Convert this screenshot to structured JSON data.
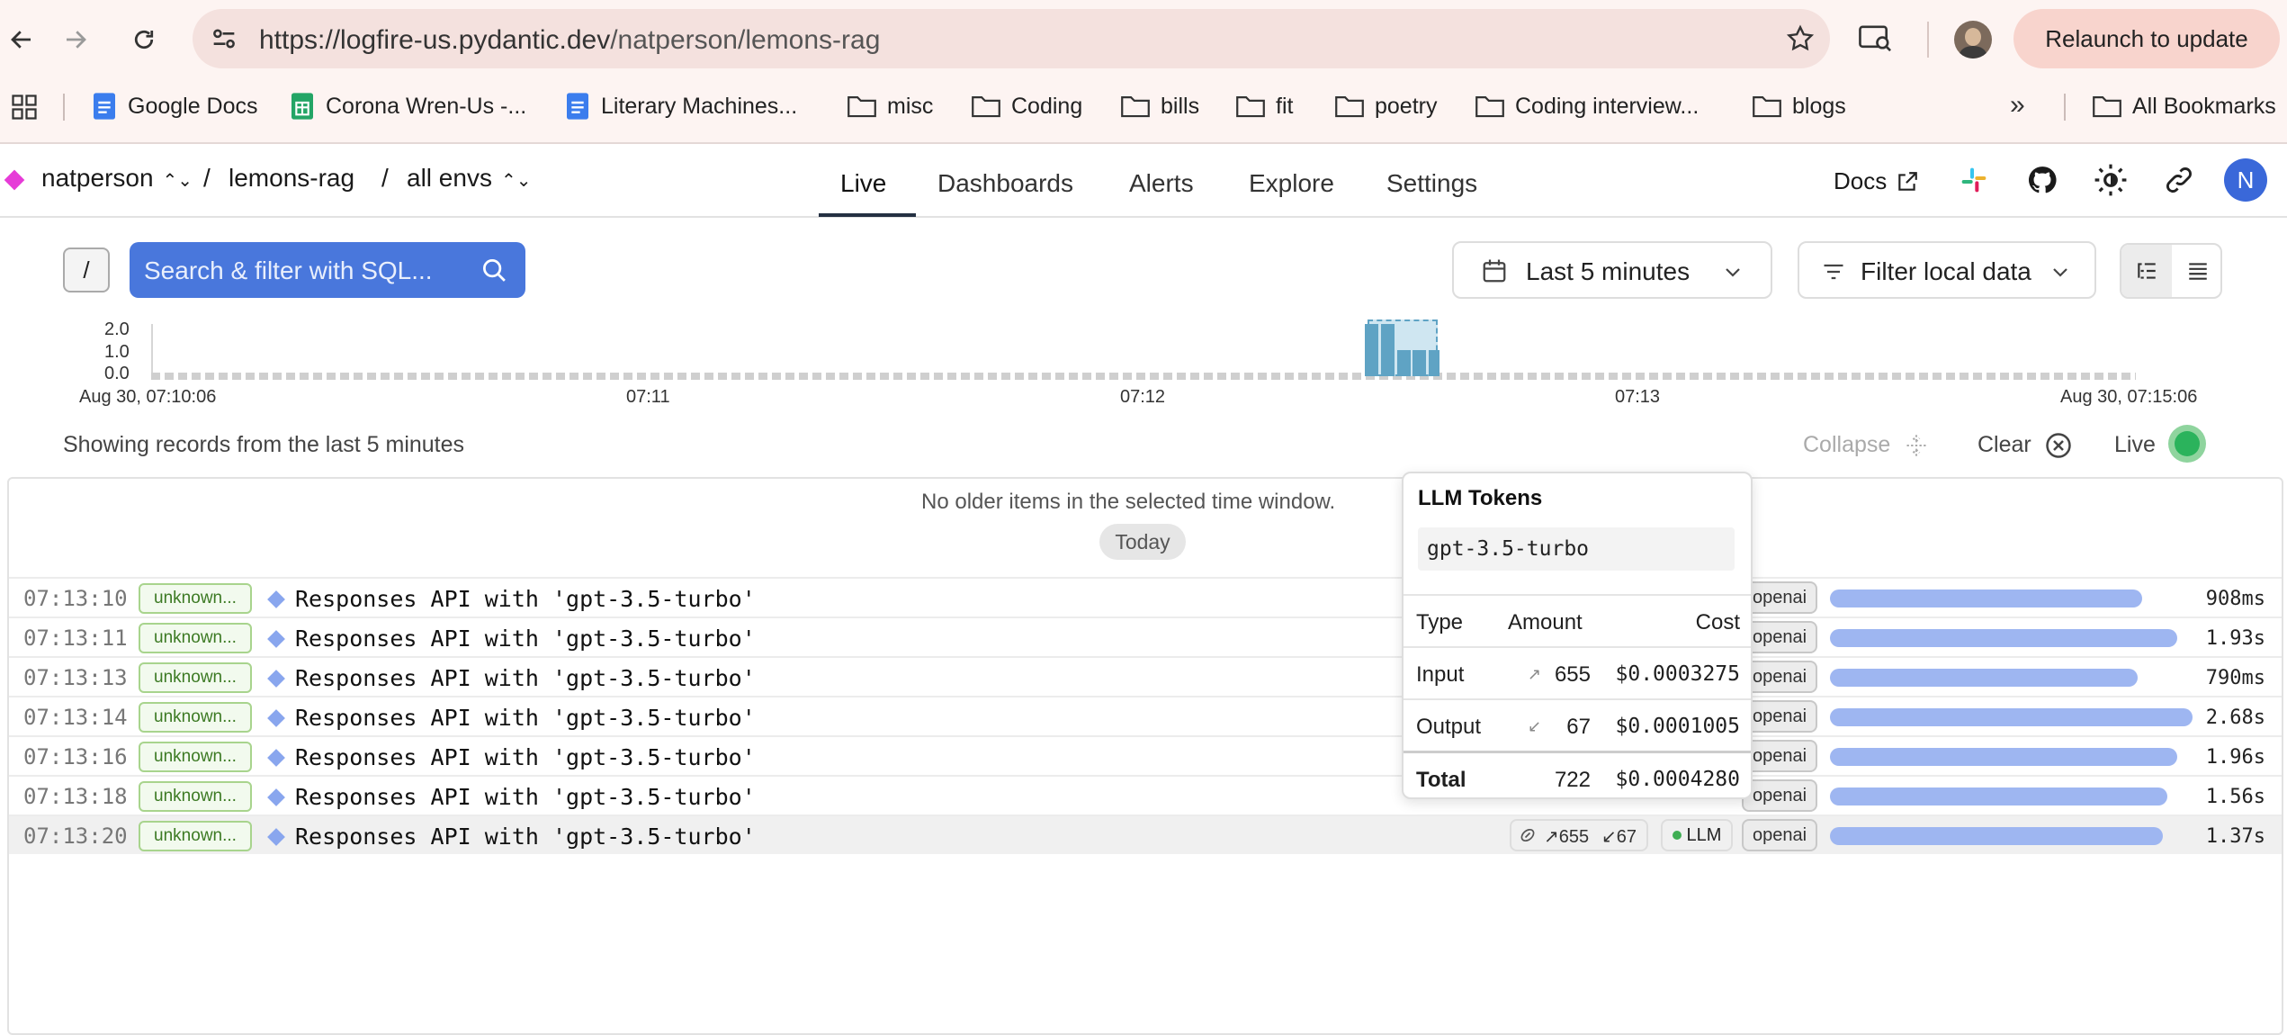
{
  "browser": {
    "url": "https://logfire-us.pydantic.dev/natperson/lemons-rag",
    "url_host": "https://logfire-us.pydantic.dev",
    "url_path": "/natperson/lemons-rag",
    "relaunch_label": "Relaunch to update",
    "bookmarks": [
      {
        "label": "Google Docs",
        "icon": "google-docs-icon"
      },
      {
        "label": "Corona Wren-Us -...",
        "icon": "google-sheets-icon"
      },
      {
        "label": "Literary Machines...",
        "icon": "google-docs-icon"
      },
      {
        "label": "misc",
        "icon": "folder-icon"
      },
      {
        "label": "Coding",
        "icon": "folder-icon"
      },
      {
        "label": "bills",
        "icon": "folder-icon"
      },
      {
        "label": "fit",
        "icon": "folder-icon"
      },
      {
        "label": "poetry",
        "icon": "folder-icon"
      },
      {
        "label": "Coding interview...",
        "icon": "folder-icon"
      },
      {
        "label": "blogs",
        "icon": "folder-icon"
      }
    ],
    "more_label": "»",
    "all_bookmarks_label": "All Bookmarks"
  },
  "header": {
    "org": "natperson",
    "project": "lemons-rag",
    "env": "all envs",
    "sep": "/",
    "tabs": [
      "Live",
      "Dashboards",
      "Alerts",
      "Explore",
      "Settings"
    ],
    "active_tab": "Live",
    "docs_label": "Docs",
    "avatar_initial": "N"
  },
  "filters": {
    "slash_key": "/",
    "search_placeholder": "Search & filter with SQL...",
    "time_range": "Last 5 minutes",
    "local_filter": "Filter local data"
  },
  "histogram": {
    "y_ticks": [
      "2.0",
      "1.0",
      "0.0"
    ],
    "x_ticks": [
      "Aug 30, 07:10:06",
      "07:11",
      "07:12",
      "07:13",
      "Aug 30, 07:15:06"
    ],
    "bars": [
      2,
      2,
      1,
      1,
      1
    ]
  },
  "status": {
    "showing": "Showing records from the last 5 minutes",
    "collapse": "Collapse",
    "clear": "Clear",
    "live": "Live"
  },
  "table": {
    "no_older": "No older items in the selected time window.",
    "today": "Today",
    "rows": [
      {
        "time": "07:13:10",
        "service": "unknown...",
        "message": "Responses API with 'gpt-3.5-turbo'",
        "tag": "openai",
        "duration": "908ms",
        "dur_frac": 0.62
      },
      {
        "time": "07:13:11",
        "service": "unknown...",
        "message": "Responses API with 'gpt-3.5-turbo'",
        "tag": "openai",
        "duration": "1.93s",
        "dur_frac": 0.69
      },
      {
        "time": "07:13:13",
        "service": "unknown...",
        "message": "Responses API with 'gpt-3.5-turbo'",
        "tag": "openai",
        "duration": "790ms",
        "dur_frac": 0.61
      },
      {
        "time": "07:13:14",
        "service": "unknown...",
        "message": "Responses API with 'gpt-3.5-turbo'",
        "tag": "openai",
        "duration": "2.68s",
        "dur_frac": 0.72
      },
      {
        "time": "07:13:16",
        "service": "unknown...",
        "message": "Responses API with 'gpt-3.5-turbo'",
        "tag": "openai",
        "duration": "1.96s",
        "dur_frac": 0.69
      },
      {
        "time": "07:13:18",
        "service": "unknown...",
        "message": "Responses API with 'gpt-3.5-turbo'",
        "tag": "openai",
        "duration": "1.56s",
        "dur_frac": 0.67
      },
      {
        "time": "07:13:20",
        "service": "unknown...",
        "message": "Responses API with 'gpt-3.5-turbo'",
        "tag": "openai",
        "duration": "1.37s",
        "dur_frac": 0.66,
        "tokens_in": "655",
        "tokens_out": "67",
        "kind": "LLM"
      }
    ]
  },
  "tooltip": {
    "title": "LLM Tokens",
    "model": "gpt-3.5-turbo",
    "headers": [
      "Type",
      "Amount",
      "Cost"
    ],
    "rows": [
      {
        "type": "Input",
        "arrow": "↗",
        "amount": "655",
        "cost": "$0.0003275"
      },
      {
        "type": "Output",
        "arrow": "↙",
        "amount": "67",
        "cost": "$0.0001005"
      },
      {
        "type": "Total",
        "arrow": "",
        "amount": "722",
        "cost": "$0.0004280"
      }
    ]
  }
}
